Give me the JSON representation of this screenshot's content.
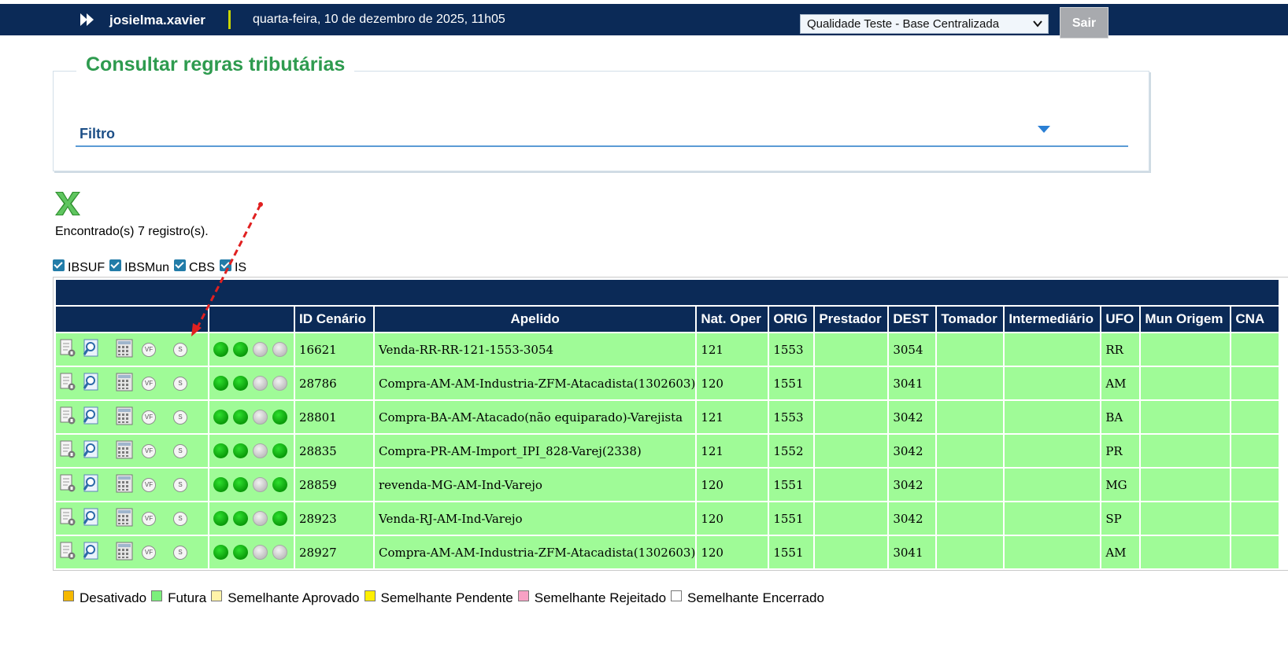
{
  "header": {
    "username": "josielma.xavier",
    "datetime": "quarta-feira, 10 de dezembro de 2025, 11h05",
    "base_select": "Qualidade Teste - Base Centralizada",
    "exit_label": "Sair"
  },
  "page": {
    "title": "Consultar regras tributárias",
    "filter_label": "Filtro",
    "count_text": "Encontrado(s) 7 registro(s)."
  },
  "checkboxes": [
    {
      "label": "IBSUF",
      "checked": true
    },
    {
      "label": "IBSMun",
      "checked": true
    },
    {
      "label": "CBS",
      "checked": true
    },
    {
      "label": "IS",
      "checked": true
    }
  ],
  "table": {
    "headers": {
      "id": "ID Cenário",
      "apelido": "Apelido",
      "natoper": "Nat. Oper",
      "orig": "ORIG",
      "prestador": "Prestador",
      "dest": "DEST",
      "tomador": "Tomador",
      "intermediario": "Intermediário",
      "ufo": "UFO",
      "mun_origem": "Mun Origem",
      "cna": "CNA"
    },
    "action_icons": [
      "document-icon",
      "search-icon",
      "calculator-icon",
      "vf-icon",
      "s-icon"
    ],
    "vf_text": "VF",
    "s_text": "S",
    "rows": [
      {
        "id": "16621",
        "apelido": "Venda-RR-RR-121-1553-3054",
        "natoper": "121",
        "orig": "1553",
        "prestador": "",
        "dest": "3054",
        "tomador": "",
        "intermediario": "",
        "ufo": "RR",
        "mun_origem": "",
        "cna": "",
        "status": [
          "green",
          "green",
          "gray",
          "gray"
        ]
      },
      {
        "id": "28786",
        "apelido": "Compra-AM-AM-Industria-ZFM-Atacadista(1302603)",
        "natoper": "120",
        "orig": "1551",
        "prestador": "",
        "dest": "3041",
        "tomador": "",
        "intermediario": "",
        "ufo": "AM",
        "mun_origem": "",
        "cna": "",
        "status": [
          "green",
          "green",
          "gray",
          "gray"
        ]
      },
      {
        "id": "28801",
        "apelido": "Compra-BA-AM-Atacado(não equiparado)-Varejista",
        "natoper": "121",
        "orig": "1553",
        "prestador": "",
        "dest": "3042",
        "tomador": "",
        "intermediario": "",
        "ufo": "BA",
        "mun_origem": "",
        "cna": "",
        "status": [
          "green",
          "green",
          "gray",
          "green"
        ]
      },
      {
        "id": "28835",
        "apelido": "Compra-PR-AM-Import_IPI_828-Varej(2338)",
        "natoper": "121",
        "orig": "1552",
        "prestador": "",
        "dest": "3042",
        "tomador": "",
        "intermediario": "",
        "ufo": "PR",
        "mun_origem": "",
        "cna": "",
        "status": [
          "green",
          "green",
          "gray",
          "green"
        ]
      },
      {
        "id": "28859",
        "apelido": "revenda-MG-AM-Ind-Varejo",
        "natoper": "120",
        "orig": "1551",
        "prestador": "",
        "dest": "3042",
        "tomador": "",
        "intermediario": "",
        "ufo": "MG",
        "mun_origem": "",
        "cna": "",
        "status": [
          "green",
          "green",
          "gray",
          "green"
        ]
      },
      {
        "id": "28923",
        "apelido": "Venda-RJ-AM-Ind-Varejo",
        "natoper": "120",
        "orig": "1551",
        "prestador": "",
        "dest": "3042",
        "tomador": "",
        "intermediario": "",
        "ufo": "SP",
        "mun_origem": "",
        "cna": "",
        "status": [
          "green",
          "green",
          "gray",
          "green"
        ]
      },
      {
        "id": "28927",
        "apelido": "Compra-AM-AM-Industria-ZFM-Atacadista(1302603)",
        "natoper": "120",
        "orig": "1551",
        "prestador": "",
        "dest": "3041",
        "tomador": "",
        "intermediario": "",
        "ufo": "AM",
        "mun_origem": "",
        "cna": "",
        "status": [
          "green",
          "green",
          "gray",
          "gray"
        ]
      }
    ]
  },
  "legend": [
    {
      "label": "Desativado",
      "color": "#f5b800"
    },
    {
      "label": "Futura",
      "color": "#7cf07c"
    },
    {
      "label": "Semelhante Aprovado",
      "color": "#fff3a8"
    },
    {
      "label": "Semelhante Pendente",
      "color": "#ffef00"
    },
    {
      "label": "Semelhante Rejeitado",
      "color": "#f7a1c4"
    },
    {
      "label": "Semelhante Encerrado",
      "color": "#ffffff"
    }
  ],
  "colors": {
    "topbar": "#0b2a57",
    "row_bg": "#9ffb97",
    "title_green": "#2e9b4f",
    "annotation_arrow": "#e02020"
  }
}
